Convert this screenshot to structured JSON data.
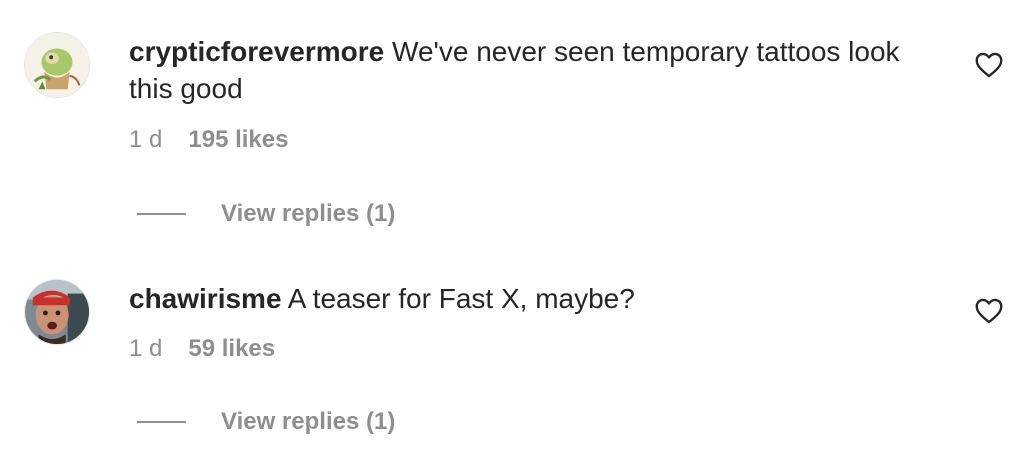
{
  "comments": [
    {
      "username": "crypticforevermore",
      "text": "We've never seen temporary tattoos look this good",
      "time": "1 d",
      "likes": "195 likes",
      "view_replies": "View replies (1)",
      "avatar": "cartoon-illustration-avatar",
      "like_icon": "heart-outline-icon"
    },
    {
      "username": "chawirisme",
      "text": "A teaser for Fast X, maybe?",
      "time": "1 d",
      "likes": "59 likes",
      "view_replies": "View replies (1)",
      "avatar": "photo-avatar",
      "like_icon": "heart-outline-icon"
    }
  ],
  "colors": {
    "text": "#262626",
    "secondary": "#8e8e8e",
    "background": "#ffffff"
  }
}
